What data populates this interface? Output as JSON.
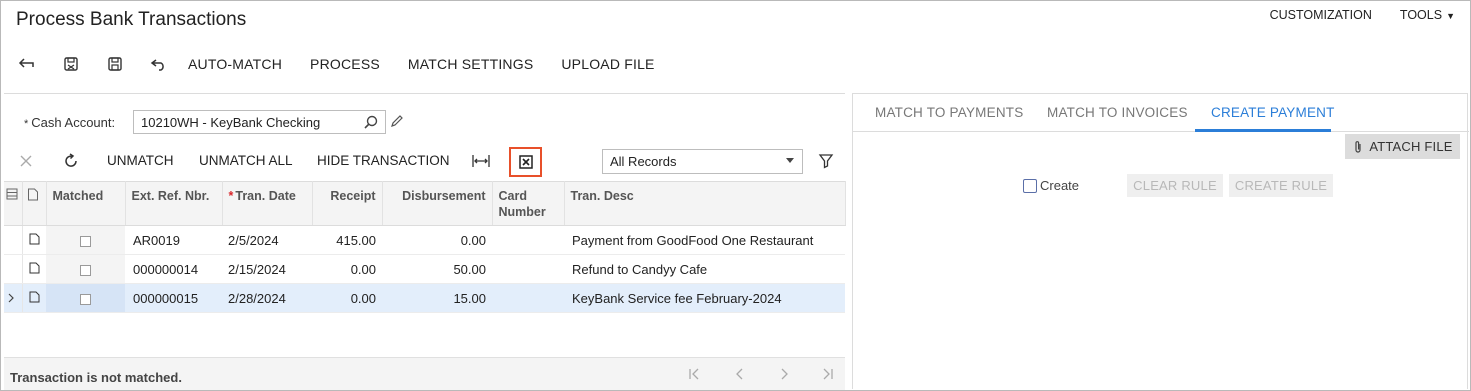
{
  "app": {
    "title": "Process Bank Transactions",
    "customization_label": "CUSTOMIZATION",
    "tools_label": "TOOLS"
  },
  "toolbar": {
    "icons": [
      "back-icon",
      "save-close-icon",
      "save-icon",
      "undo-icon"
    ],
    "buttons": [
      "AUTO-MATCH",
      "PROCESS",
      "MATCH SETTINGS",
      "UPLOAD FILE"
    ]
  },
  "filter": {
    "cash_account_label": "Cash Account:",
    "cash_account_value": "10210WH - KeyBank Checking"
  },
  "grid_toolbar": {
    "unmatch": "UNMATCH",
    "unmatch_all": "UNMATCH ALL",
    "hide_transaction": "HIDE TRANSACTION",
    "records_select": "All Records"
  },
  "grid": {
    "headers": {
      "matched": "Matched",
      "ext_ref": "Ext. Ref. Nbr.",
      "tran_date": "Tran. Date",
      "receipt": "Receipt",
      "disbursement": "Disbursement",
      "card_number": "Card Number",
      "tran_desc": "Tran. Desc"
    },
    "rows": [
      {
        "ext_ref": "AR0019",
        "tran_date": "2/5/2024",
        "receipt": "415.00",
        "disbursement": "0.00",
        "card_number": "",
        "tran_desc": "Payment from GoodFood One Restaurant"
      },
      {
        "ext_ref": "000000014",
        "tran_date": "2/15/2024",
        "receipt": "0.00",
        "disbursement": "50.00",
        "card_number": "",
        "tran_desc": "Refund to Candyy Cafe"
      },
      {
        "ext_ref": "000000015",
        "tran_date": "2/28/2024",
        "receipt": "0.00",
        "disbursement": "15.00",
        "card_number": "",
        "tran_desc": "KeyBank Service fee February-2024"
      }
    ]
  },
  "status": {
    "text": "Transaction is not matched."
  },
  "right_panel": {
    "tabs": [
      "MATCH TO PAYMENTS",
      "MATCH TO INVOICES",
      "CREATE PAYMENT"
    ],
    "active_tab": "CREATE PAYMENT",
    "attach_file": "ATTACH FILE",
    "create_label": "Create",
    "clear_rule": "CLEAR RULE",
    "create_rule": "CREATE RULE"
  },
  "colors": {
    "accent": "#2b7ed8",
    "highlight_border": "#e8502a",
    "selected_row": "#e3eefb"
  }
}
